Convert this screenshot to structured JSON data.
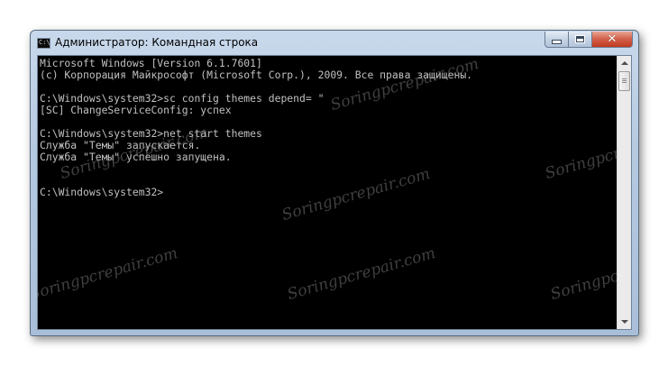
{
  "window": {
    "title": "Администратор: Командная строка",
    "icon_label": "C:\\",
    "controls": {
      "minimize_icon": "minimize-icon",
      "maximize_icon": "maximize-icon",
      "close_icon": "close-icon",
      "close_glyph": "✕"
    }
  },
  "console": {
    "lines": [
      "Microsoft Windows [Version 6.1.7601]",
      "(c) Корпорация Майкрософт (Microsoft Corp.), 2009. Все права защищены.",
      "",
      "C:\\Windows\\system32>sc config themes depend= \"",
      "[SC] ChangeServiceConfig: успех",
      "",
      "C:\\Windows\\system32>net start themes",
      "Служба \"Темы\" запускается.",
      "Служба \"Темы\" успешно запущена.",
      "",
      "",
      "C:\\Windows\\system32>"
    ],
    "colors": {
      "background": "#000000",
      "foreground": "#c0c0c0"
    }
  },
  "watermark": {
    "text": "Soringpcrepair.com"
  }
}
